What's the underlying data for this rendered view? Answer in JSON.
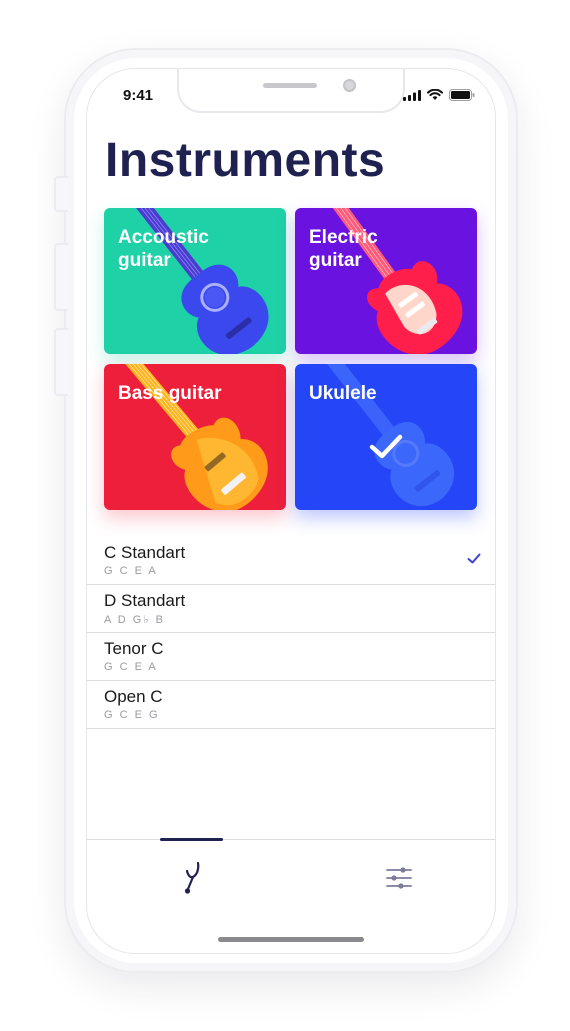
{
  "status_bar": {
    "time": "9:41",
    "signal_icon": "signal-icon",
    "wifi_icon": "wifi-icon",
    "battery_icon": "battery-icon"
  },
  "page": {
    "title": "Instruments"
  },
  "instruments": [
    {
      "label": "Accoustic guitar",
      "color": "#1fd1a6",
      "icon": "acoustic-guitar-icon",
      "selected": false
    },
    {
      "label": "Electric guitar",
      "color": "#6a12e0",
      "icon": "electric-guitar-icon",
      "selected": false
    },
    {
      "label": "Bass guitar",
      "color": "#ee1f3a",
      "icon": "bass-guitar-icon",
      "selected": false
    },
    {
      "label": "Ukulele",
      "color": "#2446f6",
      "icon": "ukulele-icon",
      "selected": true
    }
  ],
  "tunings": [
    {
      "name": "C Standart",
      "notes": "G C E A",
      "selected": true
    },
    {
      "name": "D Standart",
      "notes": "A D G♭ B",
      "selected": false
    },
    {
      "name": "Tenor C",
      "notes": "G C E A",
      "selected": false
    },
    {
      "name": "Open C",
      "notes": "G C E G",
      "selected": false
    }
  ],
  "tabbar": {
    "tabs": [
      {
        "icon": "tuning-fork-icon",
        "active": true
      },
      {
        "icon": "sliders-icon",
        "active": false
      }
    ]
  },
  "colors": {
    "title": "#1f2150",
    "accent": "#3a3fd6",
    "divider": "#dcdce0"
  }
}
